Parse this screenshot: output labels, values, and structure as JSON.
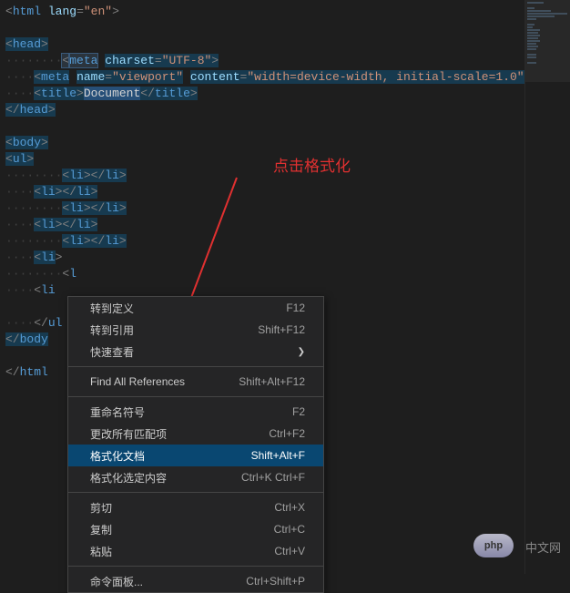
{
  "annotation": {
    "text": "点击格式化"
  },
  "code": {
    "lines": [
      {
        "indent": "",
        "parts": [
          {
            "t": "bracket",
            "v": "<"
          },
          {
            "t": "tag",
            "v": "html"
          },
          {
            "t": "text",
            "v": " "
          },
          {
            "t": "attr",
            "v": "lang"
          },
          {
            "t": "bracket",
            "v": "="
          },
          {
            "t": "str",
            "v": "\"en\""
          },
          {
            "t": "bracket",
            "v": ">"
          }
        ]
      },
      {
        "indent": "",
        "parts": []
      },
      {
        "indent": "",
        "parts": [
          {
            "t": "bracket",
            "v": "<",
            "hl": "highlight1"
          },
          {
            "t": "tag",
            "v": "head",
            "hl": "highlight1"
          },
          {
            "t": "bracket",
            "v": ">",
            "hl": "highlight1"
          }
        ]
      },
      {
        "indent": "········",
        "parts": [
          {
            "t": "bracket",
            "v": "<",
            "hl": "highlight-box"
          },
          {
            "t": "tag",
            "v": "meta",
            "hl": "highlight-box"
          },
          {
            "t": "text",
            "v": " "
          },
          {
            "t": "attr",
            "v": "charset",
            "hl": "highlight1"
          },
          {
            "t": "bracket",
            "v": "=",
            "hl": "highlight1"
          },
          {
            "t": "str",
            "v": "\"UTF-8\"",
            "hl": "highlight1"
          },
          {
            "t": "bracket",
            "v": ">",
            "hl": "highlight1"
          }
        ]
      },
      {
        "indent": "····",
        "parts": [
          {
            "t": "bracket",
            "v": "<",
            "hl": "highlight1"
          },
          {
            "t": "tag",
            "v": "meta",
            "hl": "highlight1"
          },
          {
            "t": "text",
            "v": " "
          },
          {
            "t": "attr",
            "v": "name",
            "hl": "highlight1"
          },
          {
            "t": "bracket",
            "v": "=",
            "hl": "highlight1"
          },
          {
            "t": "str",
            "v": "\"viewport\"",
            "hl": "highlight1"
          },
          {
            "t": "text",
            "v": " "
          },
          {
            "t": "attr",
            "v": "content",
            "hl": "highlight1"
          },
          {
            "t": "bracket",
            "v": "=",
            "hl": "highlight1"
          },
          {
            "t": "str",
            "v": "\"width=device-width, initial-scale=1.0\"",
            "hl": "highlight1"
          },
          {
            "t": "bracket",
            "v": ">"
          }
        ]
      },
      {
        "indent": "····",
        "parts": [
          {
            "t": "bracket",
            "v": "<",
            "hl": "highlight1"
          },
          {
            "t": "tag",
            "v": "title",
            "hl": "highlight1"
          },
          {
            "t": "bracket",
            "v": ">",
            "hl": "highlight1"
          },
          {
            "t": "text",
            "v": "Document",
            "hl": "highlight2"
          },
          {
            "t": "bracket",
            "v": "</",
            "hl": "highlight1"
          },
          {
            "t": "tag",
            "v": "title",
            "hl": "highlight1"
          },
          {
            "t": "bracket",
            "v": ">",
            "hl": "highlight1"
          }
        ]
      },
      {
        "indent": "",
        "parts": [
          {
            "t": "bracket",
            "v": "</",
            "hl": "highlight1"
          },
          {
            "t": "tag",
            "v": "head",
            "hl": "highlight1"
          },
          {
            "t": "bracket",
            "v": ">",
            "hl": "highlight1"
          }
        ]
      },
      {
        "indent": "",
        "parts": []
      },
      {
        "indent": "",
        "parts": [
          {
            "t": "bracket",
            "v": "<",
            "hl": "highlight1"
          },
          {
            "t": "tag",
            "v": "body",
            "hl": "highlight1"
          },
          {
            "t": "bracket",
            "v": ">",
            "hl": "highlight1"
          }
        ]
      },
      {
        "indent": "",
        "parts": [
          {
            "t": "bracket",
            "v": "<",
            "hl": "highlight1"
          },
          {
            "t": "tag",
            "v": "ul",
            "hl": "highlight1"
          },
          {
            "t": "bracket",
            "v": ">",
            "hl": "highlight1"
          }
        ]
      },
      {
        "indent": "········",
        "parts": [
          {
            "t": "bracket",
            "v": "<",
            "hl": "highlight1"
          },
          {
            "t": "tag",
            "v": "li",
            "hl": "highlight1"
          },
          {
            "t": "bracket",
            "v": ">",
            "hl": "highlight1"
          },
          {
            "t": "bracket",
            "v": "</",
            "hl": "highlight1"
          },
          {
            "t": "tag",
            "v": "li",
            "hl": "highlight1"
          },
          {
            "t": "bracket",
            "v": ">",
            "hl": "highlight1"
          }
        ]
      },
      {
        "indent": "····",
        "parts": [
          {
            "t": "bracket",
            "v": "<",
            "hl": "highlight1"
          },
          {
            "t": "tag",
            "v": "li",
            "hl": "highlight1"
          },
          {
            "t": "bracket",
            "v": ">",
            "hl": "highlight1"
          },
          {
            "t": "bracket",
            "v": "</",
            "hl": "highlight1"
          },
          {
            "t": "tag",
            "v": "li",
            "hl": "highlight1"
          },
          {
            "t": "bracket",
            "v": ">",
            "hl": "highlight1"
          }
        ]
      },
      {
        "indent": "········",
        "parts": [
          {
            "t": "bracket",
            "v": "<",
            "hl": "highlight1"
          },
          {
            "t": "tag",
            "v": "li",
            "hl": "highlight1"
          },
          {
            "t": "bracket",
            "v": ">",
            "hl": "highlight1"
          },
          {
            "t": "bracket",
            "v": "</",
            "hl": "highlight1"
          },
          {
            "t": "tag",
            "v": "li",
            "hl": "highlight1"
          },
          {
            "t": "bracket",
            "v": ">",
            "hl": "highlight1"
          }
        ]
      },
      {
        "indent": "····",
        "parts": [
          {
            "t": "bracket",
            "v": "<",
            "hl": "highlight1"
          },
          {
            "t": "tag",
            "v": "li",
            "hl": "highlight1"
          },
          {
            "t": "bracket",
            "v": ">",
            "hl": "highlight1"
          },
          {
            "t": "bracket",
            "v": "</",
            "hl": "highlight1"
          },
          {
            "t": "tag",
            "v": "li",
            "hl": "highlight1"
          },
          {
            "t": "bracket",
            "v": ">",
            "hl": "highlight1"
          }
        ]
      },
      {
        "indent": "········",
        "parts": [
          {
            "t": "bracket",
            "v": "<",
            "hl": "highlight1"
          },
          {
            "t": "tag",
            "v": "li",
            "hl": "highlight1"
          },
          {
            "t": "bracket",
            "v": ">",
            "hl": "highlight1"
          },
          {
            "t": "bracket",
            "v": "</",
            "hl": "highlight1"
          },
          {
            "t": "tag",
            "v": "li",
            "hl": "highlight1"
          },
          {
            "t": "bracket",
            "v": ">",
            "hl": "highlight1"
          }
        ]
      },
      {
        "indent": "····",
        "parts": [
          {
            "t": "bracket",
            "v": "<",
            "hl": "highlight1"
          },
          {
            "t": "tag",
            "v": "li",
            "hl": "highlight1"
          },
          {
            "t": "bracket",
            "v": ">"
          }
        ]
      },
      {
        "indent": "········",
        "parts": [
          {
            "t": "bracket",
            "v": "<"
          },
          {
            "t": "tag",
            "v": "l"
          }
        ]
      },
      {
        "indent": "····",
        "parts": [
          {
            "t": "bracket",
            "v": "<"
          },
          {
            "t": "tag",
            "v": "li"
          }
        ]
      },
      {
        "indent": "",
        "parts": []
      },
      {
        "indent": "····",
        "parts": [
          {
            "t": "bracket",
            "v": "</"
          },
          {
            "t": "tag",
            "v": "ul"
          }
        ]
      },
      {
        "indent": "",
        "parts": [
          {
            "t": "bracket",
            "v": "</",
            "hl": "highlight1"
          },
          {
            "t": "tag",
            "v": "body",
            "hl": "highlight1"
          }
        ]
      },
      {
        "indent": "",
        "parts": []
      },
      {
        "indent": "",
        "parts": [
          {
            "t": "bracket",
            "v": "</"
          },
          {
            "t": "tag",
            "v": "html"
          }
        ]
      }
    ]
  },
  "menu": {
    "items": [
      {
        "label": "转到定义",
        "shortcut": "F12",
        "type": "item"
      },
      {
        "label": "转到引用",
        "shortcut": "Shift+F12",
        "type": "item"
      },
      {
        "label": "快速查看",
        "shortcut": "",
        "submenu": true,
        "type": "item"
      },
      {
        "type": "sep"
      },
      {
        "label": "Find All References",
        "shortcut": "Shift+Alt+F12",
        "type": "item"
      },
      {
        "type": "sep"
      },
      {
        "label": "重命名符号",
        "shortcut": "F2",
        "type": "item"
      },
      {
        "label": "更改所有匹配项",
        "shortcut": "Ctrl+F2",
        "type": "item"
      },
      {
        "label": "格式化文档",
        "shortcut": "Shift+Alt+F",
        "type": "item",
        "selected": true
      },
      {
        "label": "格式化选定内容",
        "shortcut": "Ctrl+K Ctrl+F",
        "type": "item"
      },
      {
        "type": "sep"
      },
      {
        "label": "剪切",
        "shortcut": "Ctrl+X",
        "type": "item"
      },
      {
        "label": "复制",
        "shortcut": "Ctrl+C",
        "type": "item"
      },
      {
        "label": "粘贴",
        "shortcut": "Ctrl+V",
        "type": "item"
      },
      {
        "type": "sep"
      },
      {
        "label": "命令面板...",
        "shortcut": "Ctrl+Shift+P",
        "type": "item"
      }
    ]
  },
  "watermark": {
    "logo": "php",
    "text": "中文网"
  }
}
